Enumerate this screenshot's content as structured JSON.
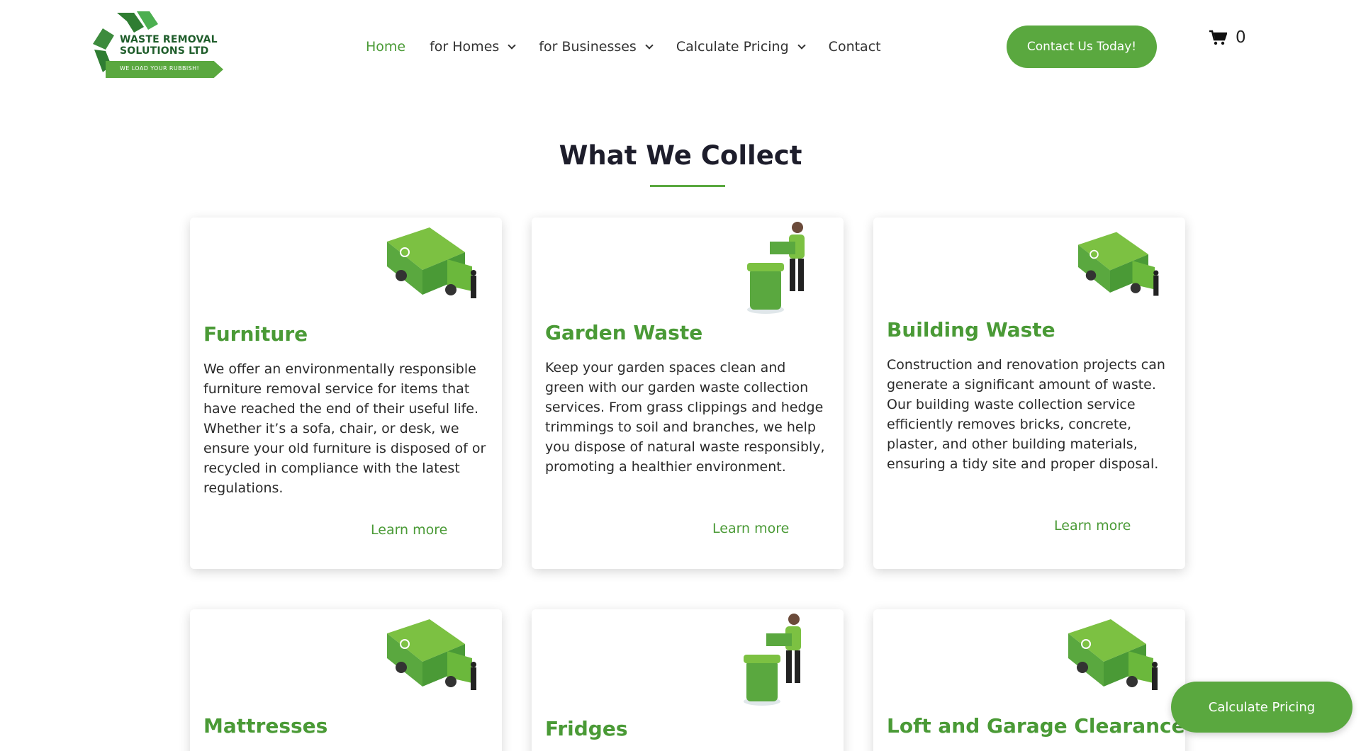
{
  "logo": {
    "line1": "WASTE REMOVAL",
    "line2": "SOLUTIONS LTD",
    "tagline": "WE LOAD YOUR RUBBISH!"
  },
  "nav": {
    "items": [
      {
        "label": "Home",
        "active": true,
        "dropdown": false
      },
      {
        "label": "for Homes",
        "active": false,
        "dropdown": true
      },
      {
        "label": "for Businesses",
        "active": false,
        "dropdown": true
      },
      {
        "label": "Calculate Pricing",
        "active": false,
        "dropdown": true
      },
      {
        "label": "Contact",
        "active": false,
        "dropdown": false
      }
    ]
  },
  "header": {
    "cta_label": "Contact Us Today!",
    "cart_count": "0",
    "cart_icon": "shopping-cart-icon"
  },
  "section": {
    "title": "What We Collect"
  },
  "cards": [
    {
      "title": "Furniture",
      "illustration": "garbage-truck-icon",
      "text": "We offer an environmentally responsible furniture removal service for items that have reached the end of their useful life. Whether it’s a sofa, chair, or desk, we ensure your old furniture is disposed of or recycled in compliance with the latest regulations.",
      "link": "Learn more"
    },
    {
      "title": "Garden Waste",
      "illustration": "worker-with-bin-icon",
      "text": "Keep your garden spaces clean and green with our garden waste collection services. From grass clippings and hedge trimmings to soil and branches, we help you dispose of natural waste responsibly, promoting a healthier environment.",
      "link": "Learn more"
    },
    {
      "title": "Building Waste",
      "illustration": "garbage-truck-icon",
      "text": "Construction and renovation projects can generate a significant amount of waste. Our building waste collection service efficiently removes bricks, concrete, plaster, and other building materials, ensuring a tidy site and proper disposal.",
      "link": "Learn more"
    },
    {
      "title": "Mattresses",
      "illustration": "garbage-truck-icon"
    },
    {
      "title": "Fridges",
      "illustration": "worker-with-bin-icon"
    },
    {
      "title": "Loft and Garage Clearance",
      "illustration": "garbage-truck-icon"
    }
  ],
  "floating_button": {
    "label": "Calculate Pricing"
  },
  "colors": {
    "brand_green": "#5aa83f",
    "link_green": "#4a9a36",
    "heading_dark": "#1d1d2b"
  }
}
